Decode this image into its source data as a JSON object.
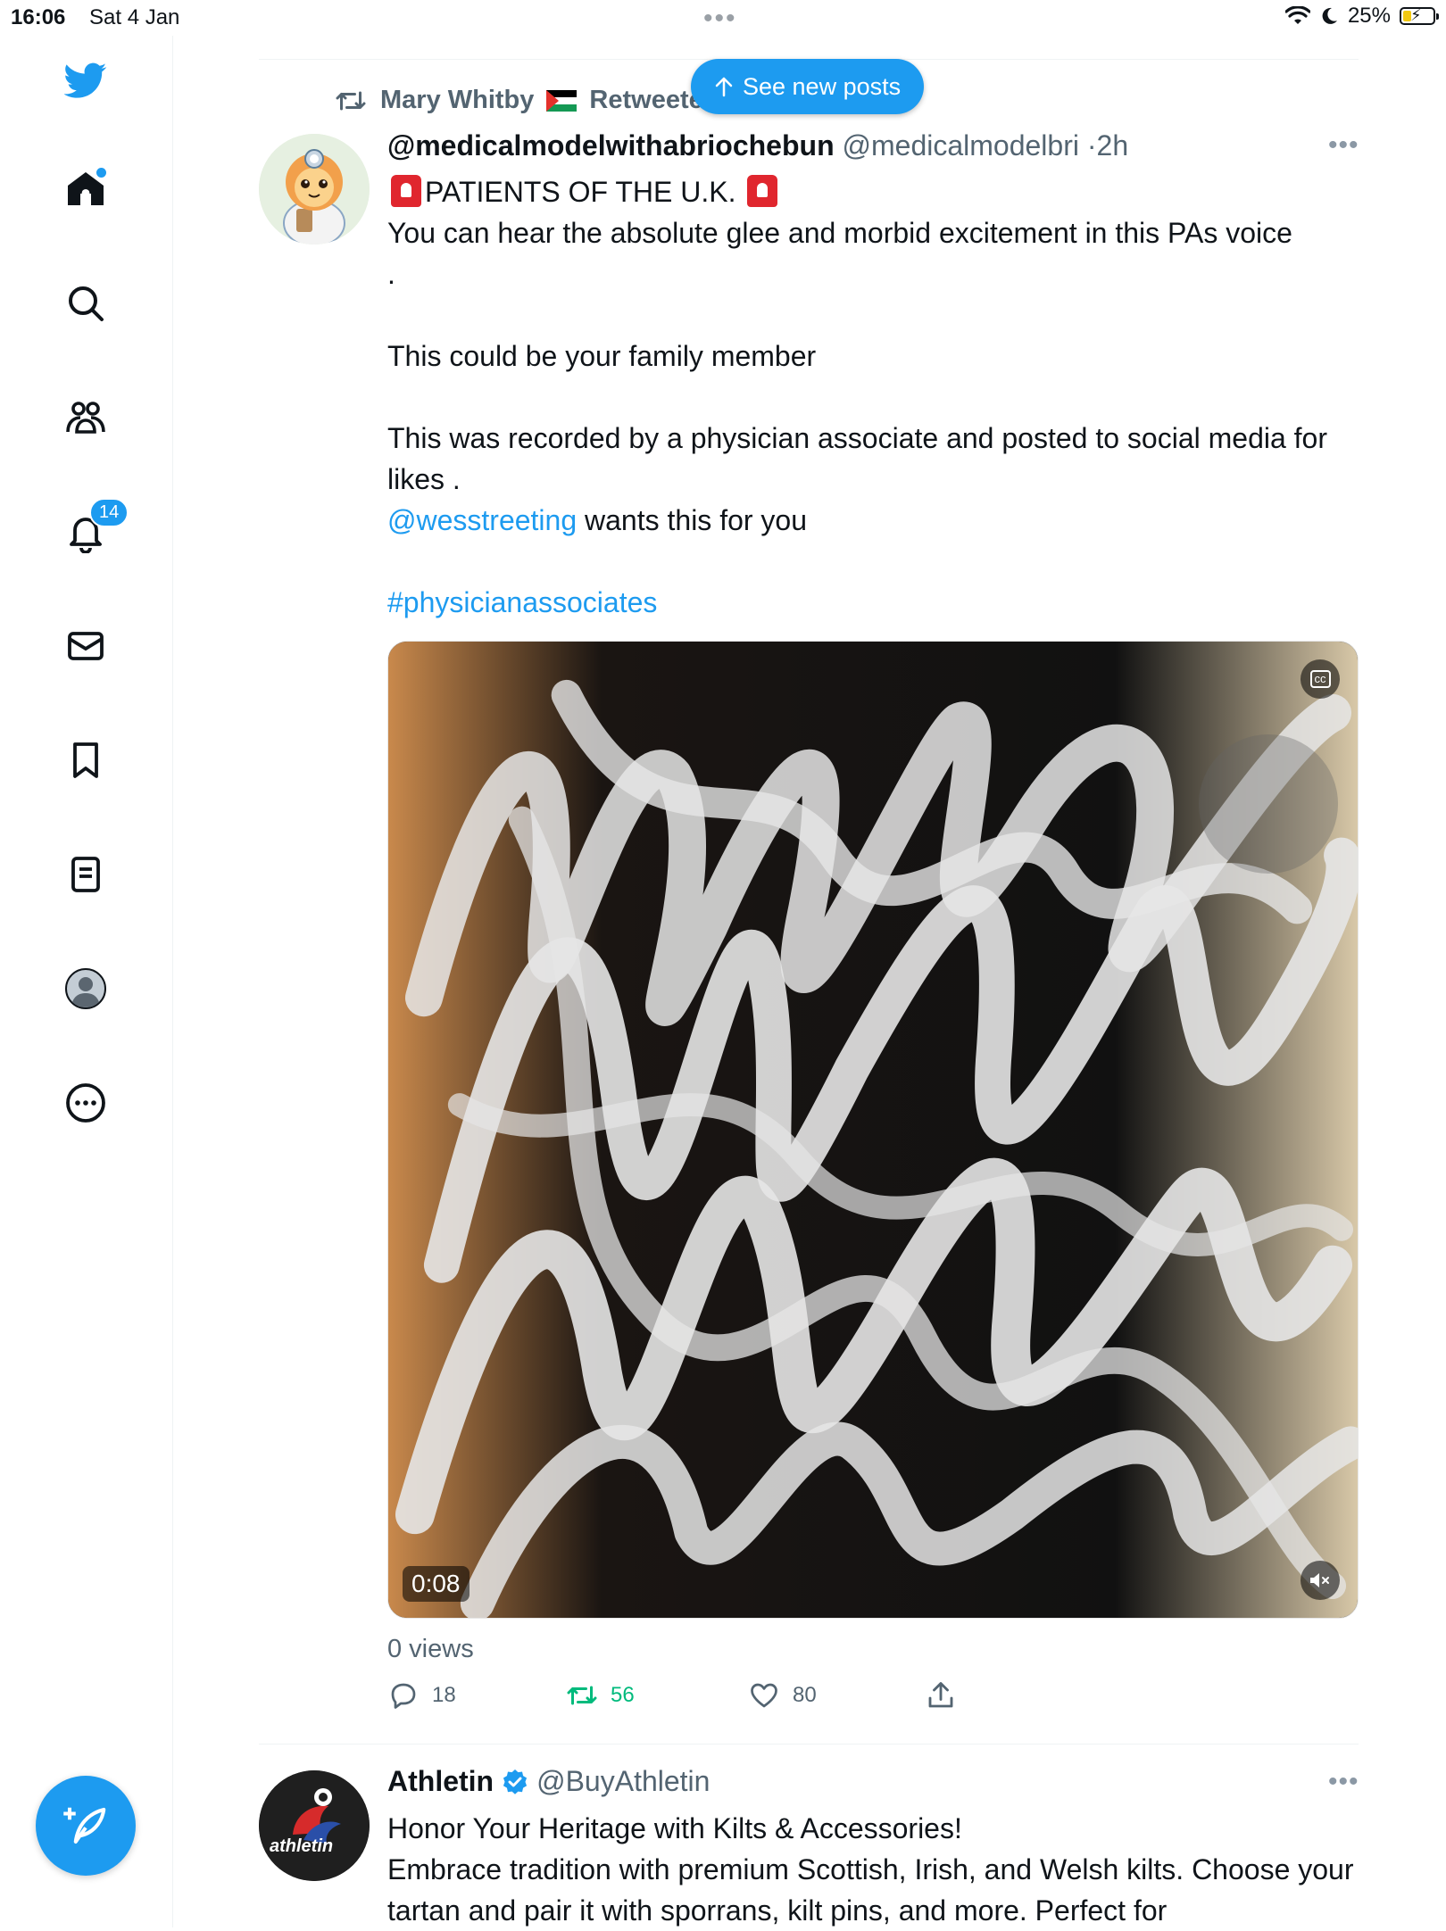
{
  "status_bar": {
    "time": "16:06",
    "date": "Sat 4 Jan",
    "battery": "25%"
  },
  "sidebar": {
    "notifications_badge": "14"
  },
  "feed": {
    "see_new_posts": "See new posts",
    "tweet1": {
      "retweet_context": "Mary Whitby",
      "retweet_suffix": "Retweeted",
      "display_name": "@medicalmodelwithabriochebun",
      "handle": "@medicalmodelbri",
      "time": "2h",
      "line1": "PATIENTS OF THE U.K.",
      "line2": "You can hear the absolute glee and morbid excitement in this PAs voice",
      "line3": ".",
      "line4": "This could be your family member",
      "line5": "This was recorded by a physician associate and posted to social media for likes .",
      "mention": "@wesstreeting",
      "mention_suffix": " wants this for you",
      "hashtag": "#physicianassociates",
      "video_duration": "0:08",
      "views": "0 views",
      "replies": "18",
      "retweets": "56",
      "likes": "80"
    },
    "tweet2": {
      "display_name": "Athletin",
      "handle": "@BuyAthletin",
      "avatar_text": "athletin",
      "line1": "Honor Your Heritage with Kilts & Accessories!",
      "line2": "Embrace tradition with premium Scottish, Irish, and Welsh kilts. Choose your tartan and pair it with sporrans, kilt pins, and more. Perfect for"
    }
  },
  "colors": {
    "accent": "#1d9bf0",
    "retweet_green": "#00ba7c",
    "secondary_text": "#536471"
  }
}
